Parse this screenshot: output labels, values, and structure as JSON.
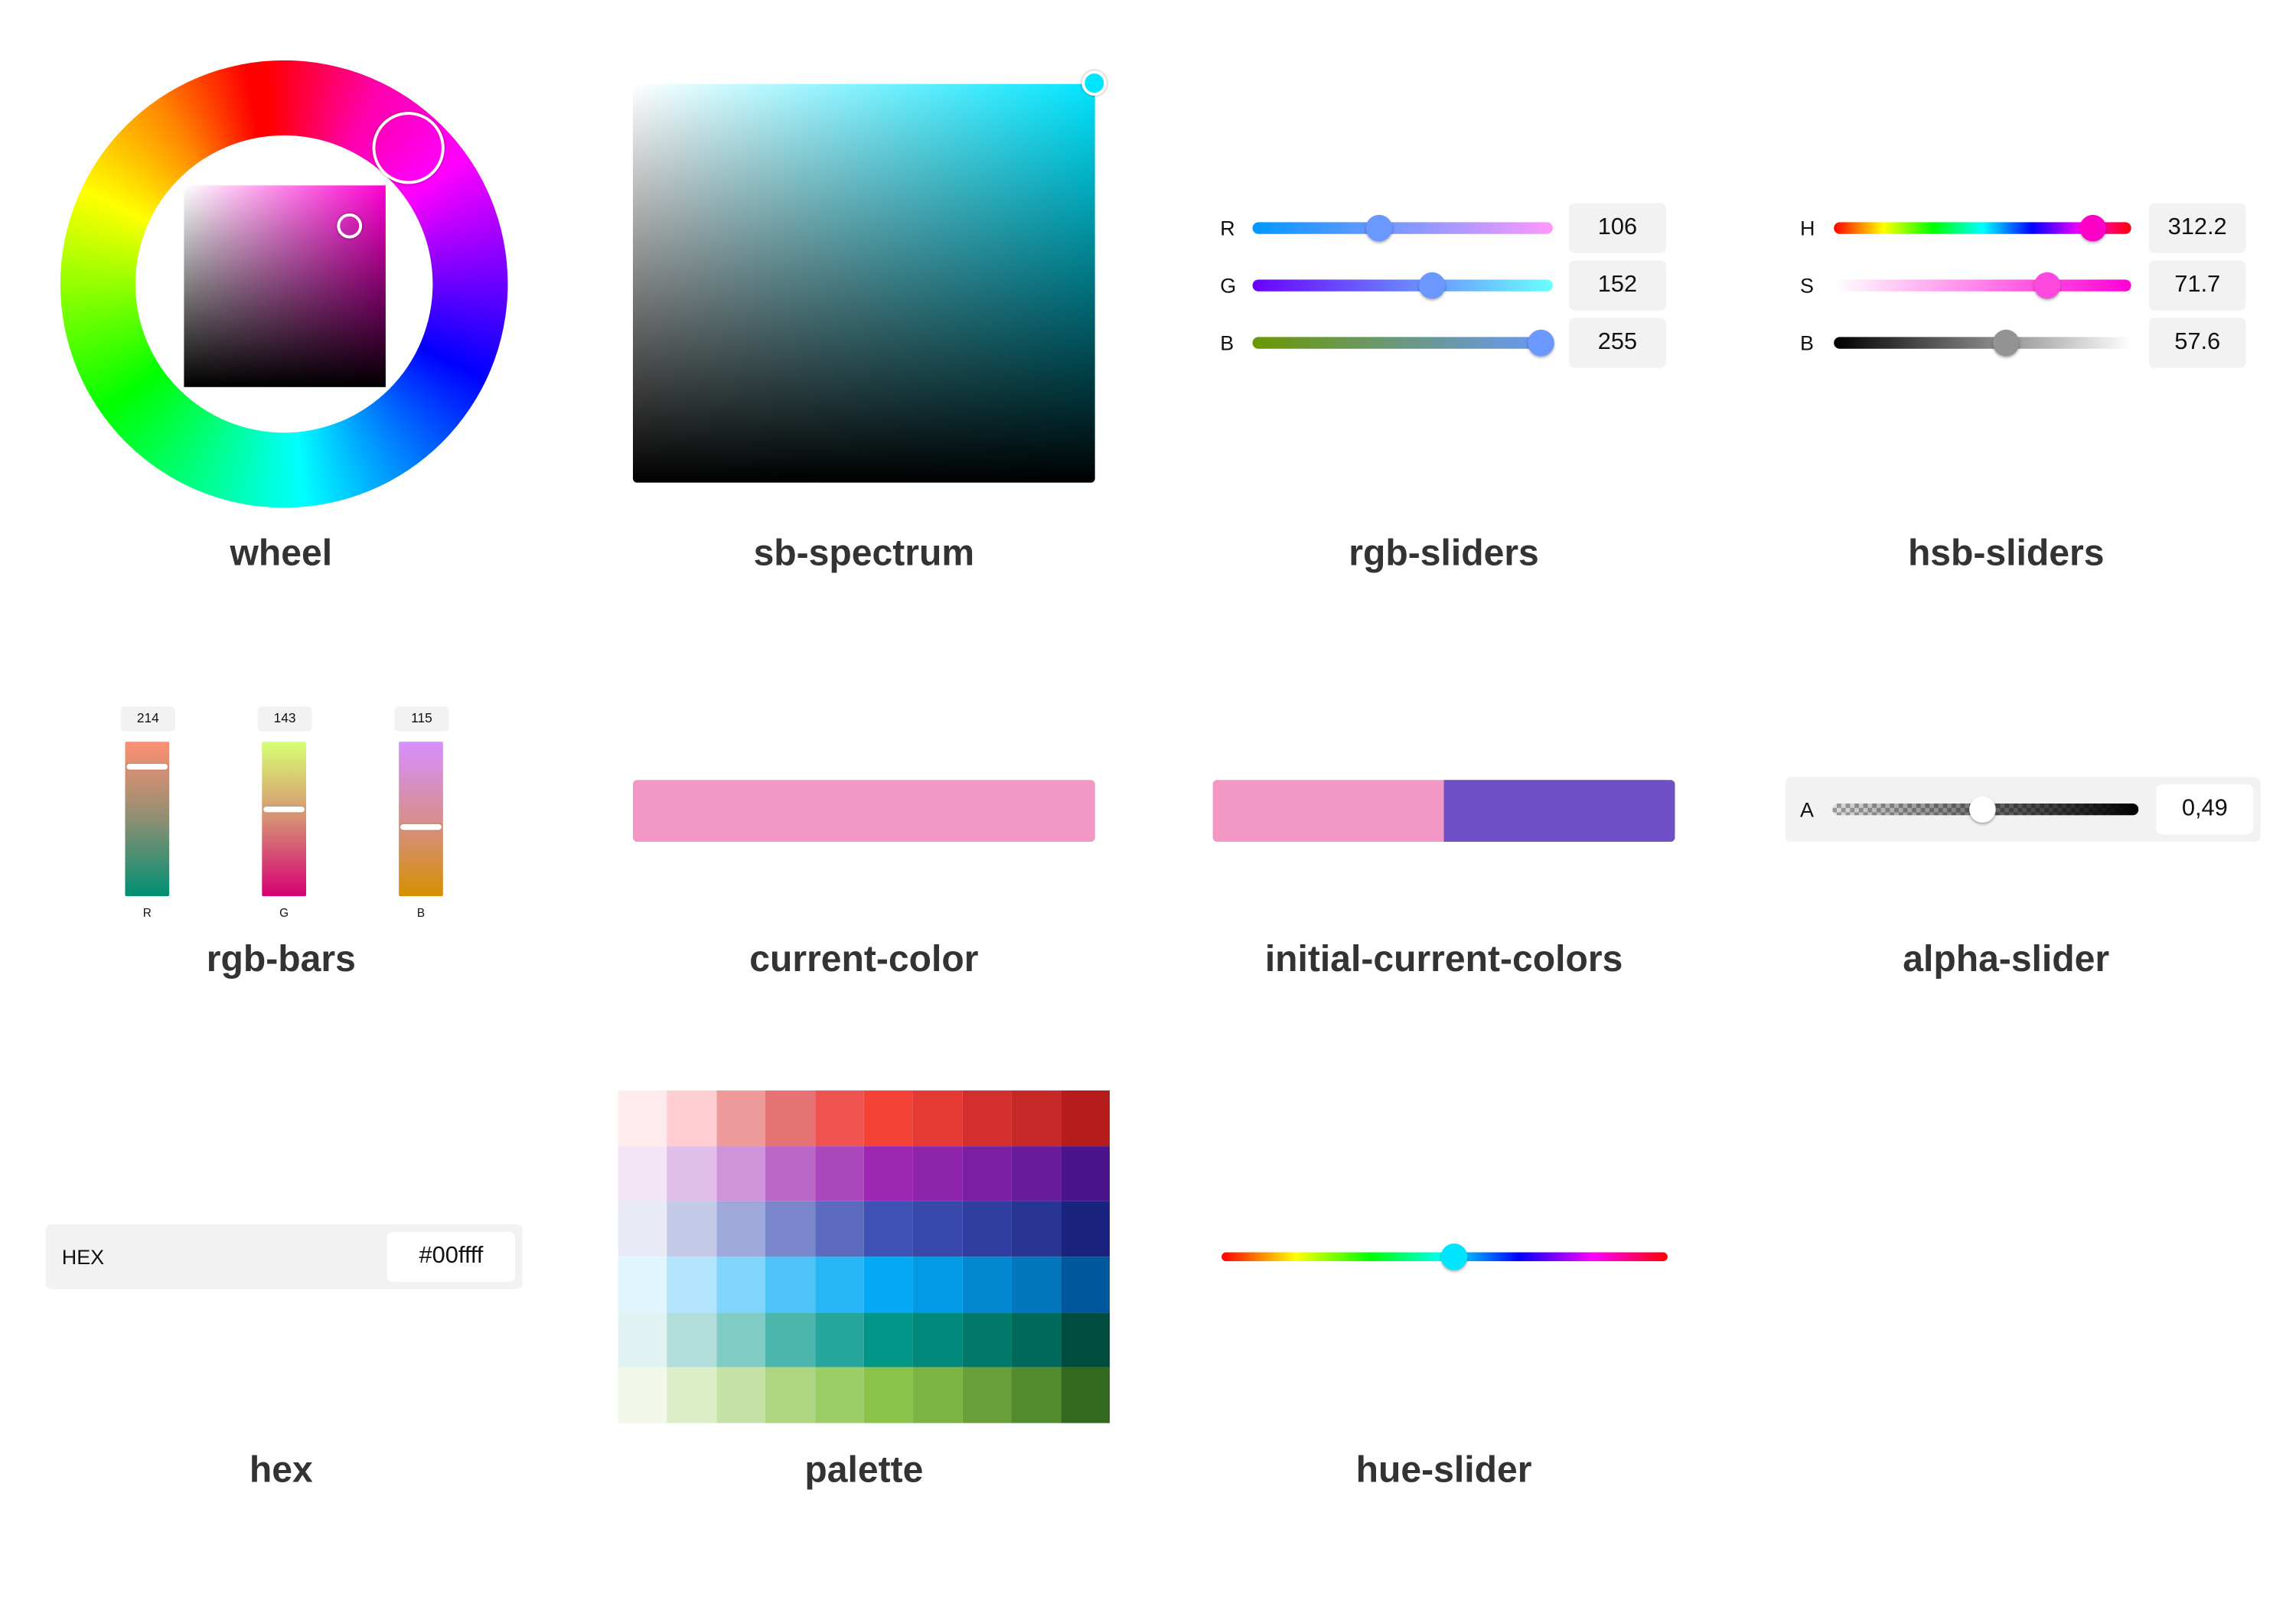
{
  "captions": {
    "wheel": "wheel",
    "sb_spectrum": "sb-spectrum",
    "rgb_sliders": "rgb-sliders",
    "hsb_sliders": "hsb-sliders",
    "rgb_bars": "rgb-bars",
    "current_color": "current-color",
    "initial_current_colors": "initial-current-colors",
    "alpha_slider": "alpha-slider",
    "hex": "hex",
    "palette": "palette",
    "hue_slider": "hue-slider"
  },
  "rgb_sliders": [
    {
      "label": "R",
      "value": "106",
      "fraction": 0.42
    },
    {
      "label": "G",
      "value": "152",
      "fraction": 0.6
    },
    {
      "label": "B",
      "value": "255",
      "fraction": 0.96
    }
  ],
  "hsb_sliders": [
    {
      "label": "H",
      "value": "312.2",
      "fraction": 0.87
    },
    {
      "label": "S",
      "value": "71.7",
      "fraction": 0.72
    },
    {
      "label": "B",
      "value": "57.6",
      "fraction": 0.58
    }
  ],
  "rgb_bars": [
    {
      "label": "R",
      "value": "214"
    },
    {
      "label": "G",
      "value": "143"
    },
    {
      "label": "B",
      "value": "115"
    }
  ],
  "current_color": "#f398c4",
  "initial_color": "#f398c4",
  "initial_current_second": "#6e4fc6",
  "alpha": {
    "label": "A",
    "value": "0,49",
    "fraction": 0.49
  },
  "hex": {
    "label": "HEX",
    "value": "#00ffff"
  },
  "hue_slider": {
    "fraction": 0.52,
    "color": "#00e5ff"
  },
  "palette": [
    [
      "#FFEBEE",
      "#FFCDD2",
      "#EF9A9A",
      "#E57373",
      "#EF5350",
      "#F44336",
      "#E53935",
      "#D32F2F",
      "#C62828",
      "#B71C1C"
    ],
    [
      "#F3E5F5",
      "#E1BEE7",
      "#CE93D8",
      "#BA68C8",
      "#AB47BC",
      "#9C27B0",
      "#8E24AA",
      "#7B1FA2",
      "#6A1B9A",
      "#4A148C"
    ],
    [
      "#E8EAF6",
      "#C5CAE9",
      "#9FA8DA",
      "#7986CB",
      "#5C6BC0",
      "#3F51B5",
      "#3949AB",
      "#303F9F",
      "#283593",
      "#1A237E"
    ],
    [
      "#E1F5FE",
      "#B3E5FC",
      "#81D4FA",
      "#4FC3F7",
      "#29B6F6",
      "#03A9F4",
      "#039BE5",
      "#0288D1",
      "#0277BD",
      "#01579B"
    ],
    [
      "#E0F2F1",
      "#B2DFDB",
      "#80CBC4",
      "#4DB6AC",
      "#26A69A",
      "#009688",
      "#00897B",
      "#00796B",
      "#00695C",
      "#004D40"
    ],
    [
      "#F1F8E9",
      "#DCEDC8",
      "#C5E1A5",
      "#AED581",
      "#9CCC65",
      "#8BC34A",
      "#7CB342",
      "#689F38",
      "#558B2F",
      "#33691E"
    ]
  ]
}
